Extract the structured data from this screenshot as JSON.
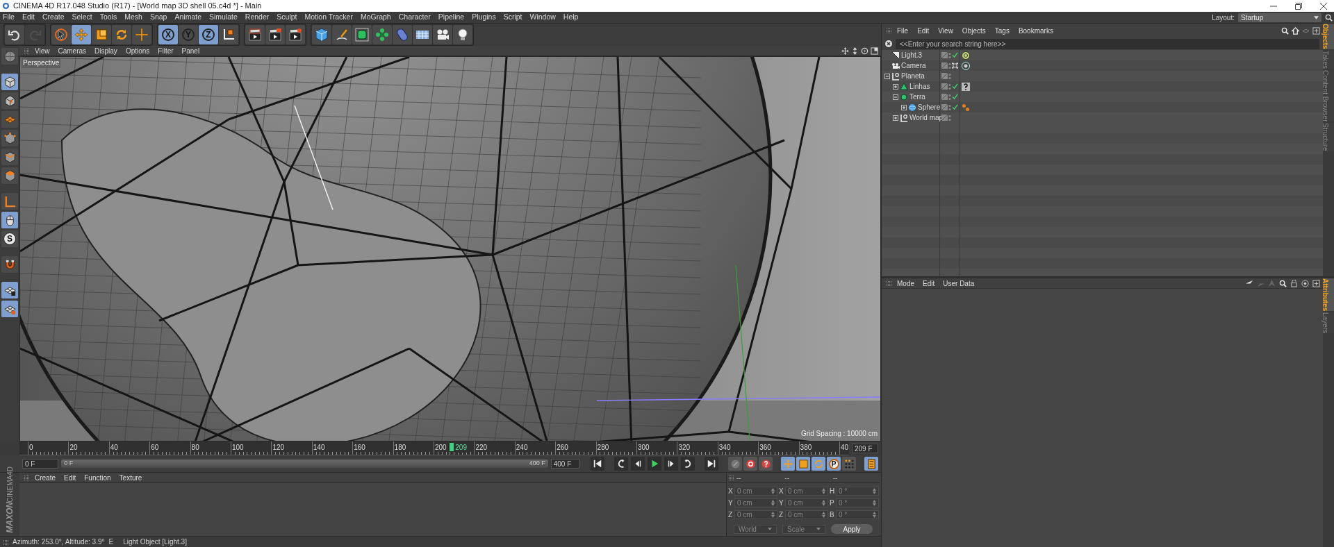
{
  "window": {
    "title": "CINEMA 4D R17.048 Studio (R17) - [World map 3D shell 05.c4d *] - Main"
  },
  "menu_bar": [
    "File",
    "Edit",
    "Create",
    "Select",
    "Tools",
    "Mesh",
    "Snap",
    "Animate",
    "Simulate",
    "Render",
    "Sculpt",
    "Motion Tracker",
    "MoGraph",
    "Character",
    "Pipeline",
    "Plugins",
    "Script",
    "Window",
    "Help"
  ],
  "layout": {
    "label": "Layout:",
    "value": "Startup"
  },
  "toolbar": [
    [
      {
        "selected": false,
        "disabled": false
      },
      {
        "selected": false,
        "disabled": true
      }
    ],
    [
      {
        "selected": false,
        "disabled": false
      },
      {
        "selected": true,
        "disabled": false
      },
      {
        "selected": false,
        "disabled": false
      },
      {
        "selected": false,
        "disabled": false
      },
      {
        "selected": false,
        "disabled": false
      }
    ],
    [
      {
        "label": "X",
        "selected": true,
        "disabled": false
      },
      {
        "label": "Y",
        "selected": false,
        "disabled": false
      },
      {
        "label": "Z",
        "selected": true,
        "disabled": false
      },
      {
        "selected": false,
        "disabled": false
      }
    ],
    [
      {
        "selected": false,
        "disabled": false
      },
      {
        "selected": false,
        "disabled": false
      },
      {
        "selected": false,
        "disabled": false
      }
    ],
    [
      {
        "selected": false,
        "disabled": false
      },
      {
        "selected": false,
        "disabled": false
      },
      {
        "selected": false,
        "disabled": false
      },
      {
        "selected": false,
        "disabled": false
      },
      {
        "selected": false,
        "disabled": false
      },
      {
        "selected": false,
        "disabled": false
      },
      {
        "selected": false,
        "disabled": false
      },
      {
        "selected": false,
        "disabled": false
      }
    ]
  ],
  "left_toolbar": [
    {
      "selected": false
    },
    {
      "selected": true
    },
    {
      "selected": false
    },
    {
      "selected": false
    },
    {
      "selected": false
    },
    {
      "selected": false
    },
    {
      "selected": false
    },
    {
      "selected": false
    },
    {
      "selected": true
    },
    {
      "label": "S",
      "selected": false
    },
    {
      "selected": false
    },
    {
      "selected": true
    },
    {
      "selected": true
    }
  ],
  "viewport": {
    "menu": [
      "View",
      "Cameras",
      "Display",
      "Options",
      "Filter",
      "Panel"
    ],
    "camera": "Perspective",
    "grid_spacing": "Grid Spacing : 10000 cm"
  },
  "timeline": {
    "ticks": [
      "0",
      "20",
      "40",
      "60",
      "80",
      "100",
      "120",
      "140",
      "160",
      "180",
      "200",
      "220",
      "240",
      "260",
      "280",
      "300",
      "320",
      "340",
      "360",
      "380",
      "40"
    ],
    "current_frame": "209",
    "level": 0.5225,
    "frame_field": "209 F"
  },
  "transport": {
    "start": "0 F",
    "range": {
      "start": "0 F",
      "end": "400 F",
      "level": 1
    },
    "end": "400 F",
    "key_buttons": [
      {
        "selected": false
      },
      {
        "selected": false
      },
      {
        "selected": false
      },
      {
        "selected": true
      },
      {
        "selected": true
      },
      {
        "selected": true
      },
      {
        "label": "P",
        "selected": true
      },
      {
        "selected": false
      },
      {
        "selected": true
      }
    ]
  },
  "material_manager": {
    "menu": [
      "Create",
      "Edit",
      "Function",
      "Texture"
    ]
  },
  "logo": [
    "MAXON",
    "CINEMA4D"
  ],
  "coordinates": {
    "headers": [
      "--",
      "--",
      "--"
    ],
    "columns": [
      [
        {
          "axis": "X",
          "value": "0 cm"
        },
        {
          "axis": "Y",
          "value": "0 cm"
        },
        {
          "axis": "Z",
          "value": "0 cm"
        }
      ],
      [
        {
          "axis": "X",
          "value": "0 cm"
        },
        {
          "axis": "Y",
          "value": "0 cm"
        },
        {
          "axis": "Z",
          "value": "0 cm"
        }
      ],
      [
        {
          "axis": "H",
          "value": "0 °"
        },
        {
          "axis": "P",
          "value": "0 °"
        },
        {
          "axis": "B",
          "value": "0 °"
        }
      ]
    ],
    "mode": "World",
    "size_mode": "Scale",
    "apply": "Apply"
  },
  "status_bar": {
    "text": "Azimuth: 253.0°, Altitude: 3.9°",
    "flag": "E",
    "message": "Light Object [Light.3]"
  },
  "object_manager": {
    "menu": [
      "File",
      "Edit",
      "View",
      "Objects",
      "Tags",
      "Bookmarks"
    ],
    "search": {
      "placeholder": "<<Enter your search string here>>"
    },
    "objects": [
      {
        "name": "Light.3",
        "kind": "light",
        "toggle": {
          "kind": "check"
        },
        "tags": [
          {
            "kind": "target"
          }
        ]
      },
      {
        "name": "Camera",
        "kind": "camera",
        "toggle": {
          "kind": "dots"
        },
        "tags": [
          {
            "kind": "focus"
          }
        ]
      },
      {
        "name": "Planeta",
        "kind": "null",
        "expanded": true,
        "children": [
          {
            "name": "Linhas",
            "kind": "spline",
            "expanded": false,
            "toggle": {
              "kind": "check"
            },
            "tags": [
              {
                "kind": "unknown"
              }
            ]
          },
          {
            "name": "Terra",
            "kind": "subdivision",
            "expanded": true,
            "toggle": {
              "kind": "check"
            },
            "children": [
              {
                "name": "Sphere",
                "kind": "sphere",
                "expanded": false,
                "toggle": {
                  "kind": "check"
                },
                "tags": [
                  {
                    "kind": "material"
                  }
                ]
              }
            ]
          },
          {
            "name": "World map",
            "kind": "null",
            "expanded": false
          }
        ]
      }
    ],
    "tabs": [
      {
        "label": "Objects",
        "selected": true
      },
      {
        "label": "Takes",
        "selected": false
      },
      {
        "label": "Content Browser",
        "selected": false
      },
      {
        "label": "Structure",
        "selected": false
      }
    ]
  },
  "attribute_manager": {
    "menu": [
      "Mode",
      "Edit",
      "User Data"
    ],
    "tabs": [
      {
        "label": "Attributes",
        "selected": true
      },
      {
        "label": "Layers",
        "selected": false
      }
    ]
  }
}
